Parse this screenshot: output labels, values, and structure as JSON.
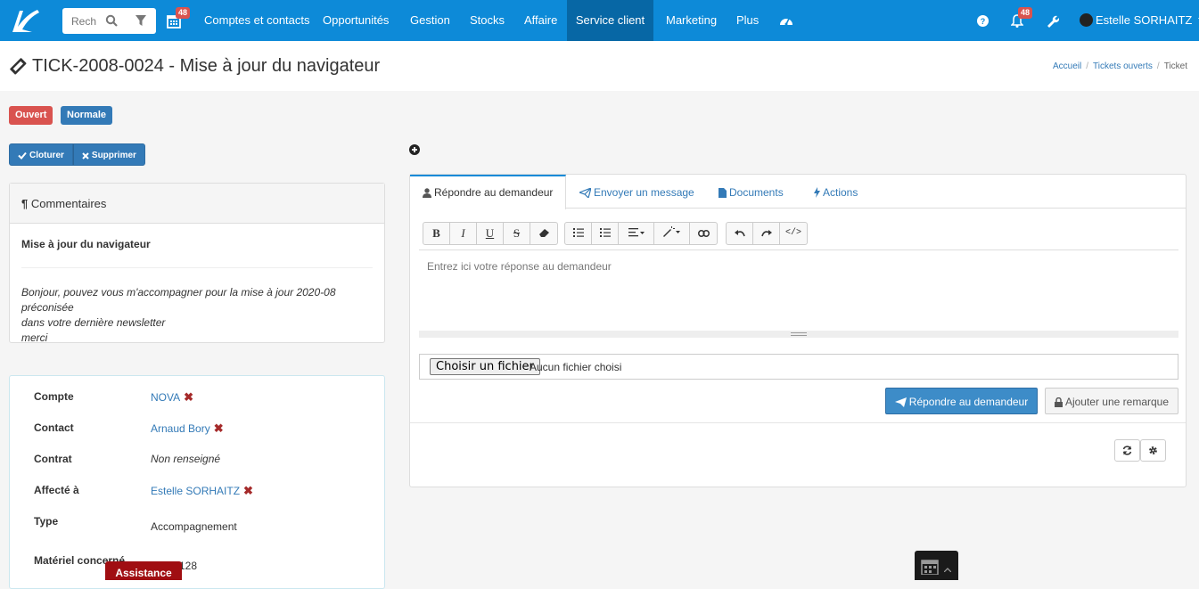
{
  "nav": {
    "search_placeholder": "Rechercher",
    "calendar_badge": "48",
    "items": [
      {
        "label": "Comptes et contacts"
      },
      {
        "label": "Opportunités"
      },
      {
        "label": "Gestion"
      },
      {
        "label": "Stocks"
      },
      {
        "label": "Affaire"
      },
      {
        "label": "Service client",
        "active": true
      },
      {
        "label": "Marketing"
      },
      {
        "label": "Plus"
      }
    ],
    "notif_badge": "48",
    "user_name": "Estelle SORHAITZ"
  },
  "header": {
    "title": "TICK-2008-0024 - Mise à jour du navigateur",
    "breadcrumb": [
      "Accueil",
      "Tickets ouverts",
      "Ticket"
    ]
  },
  "status": {
    "state": "Ouvert",
    "priority": "Normale",
    "state_color": "#d9534f",
    "priority_color": "#337ab7"
  },
  "actions": {
    "close_label": "Cloturer",
    "delete_label": "Supprimer"
  },
  "comments": {
    "heading": "Commentaires",
    "title": "Mise à jour du navigateur",
    "body_line1": "Bonjour, pouvez vous m'accompagner pour la mise à jour 2020-08 préconisée",
    "body_line2": "dans votre dernière newsletter",
    "body_line3": "merci"
  },
  "details": {
    "account_label": "Compte",
    "account_value": "NOVA",
    "contact_label": "Contact",
    "contact_value": "Arnaud Bory",
    "contract_label": "Contrat",
    "contract_value": "Non renseigné",
    "assigned_label": "Affecté à",
    "assigned_value": "Estelle SORHAITZ",
    "type_label": "Type",
    "type_value": "Accompagnement",
    "material_label": "Matériel concerné",
    "material_value": "128"
  },
  "tabs": {
    "reply": "Répondre au demandeur",
    "message": "Envoyer un message",
    "documents": "Documents",
    "actions": "Actions"
  },
  "editor": {
    "placeholder": "Entrez ici votre réponse au demandeur",
    "file_button": "Choisir un fichier",
    "file_status": "Aucun fichier choisi",
    "reply_button": "Répondre au demandeur",
    "remark_button": "Ajouter une remarque"
  },
  "floating": {
    "assistance_label": "Assistance"
  },
  "colors": {
    "topbar": "#0d8ad8",
    "active_nav": "#0767a5",
    "link": "#337ab7",
    "danger": "#d9534f"
  }
}
